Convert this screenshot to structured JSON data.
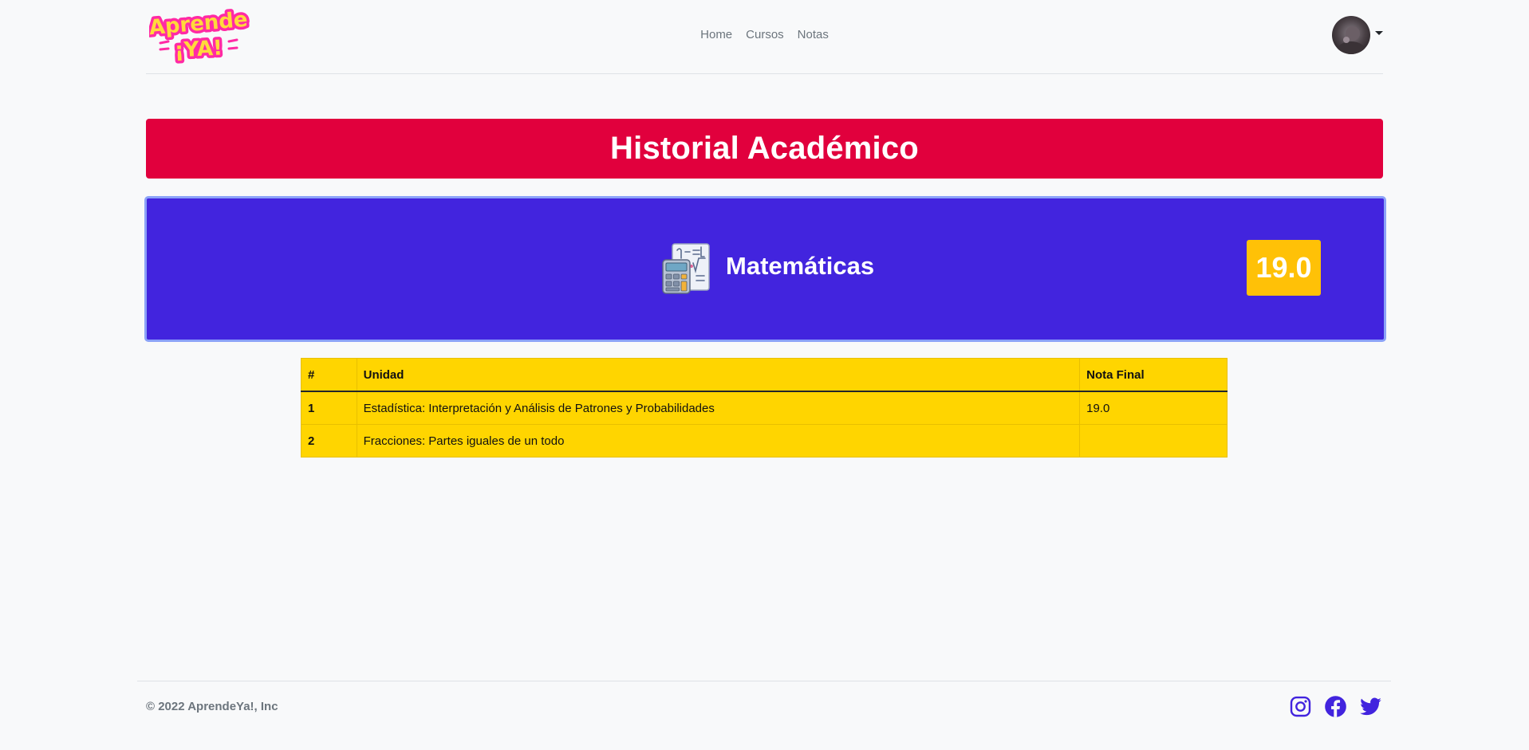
{
  "header": {
    "logo_line1": "Aprende",
    "logo_line2": "¡YA!",
    "nav": [
      "Home",
      "Cursos",
      "Notas"
    ]
  },
  "page": {
    "title": "Historial Académico"
  },
  "course": {
    "name": "Matemáticas",
    "grade": "19.0",
    "icon": "math-book-icon"
  },
  "table": {
    "headers": [
      "#",
      "Unidad",
      "Nota Final"
    ],
    "rows": [
      {
        "num": "1",
        "unit": "Estadística: Interpretación y Análisis de Patrones y Probabilidades",
        "grade": "19.0"
      },
      {
        "num": "2",
        "unit": "Fracciones: Partes iguales de un todo",
        "grade": ""
      }
    ]
  },
  "footer": {
    "copyright": "© 2022 AprendeYa!, Inc",
    "social": [
      "instagram-icon",
      "facebook-icon",
      "twitter-icon"
    ]
  },
  "colors": {
    "title_banner": "#e1003d",
    "course_card": "#4224de",
    "grade_badge": "#ffc107",
    "table_bg": "#ffd500",
    "social_icons": "#4224de"
  }
}
